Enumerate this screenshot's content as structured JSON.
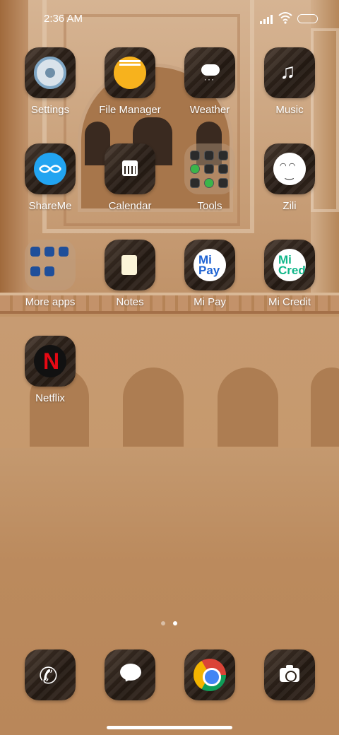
{
  "status_bar": {
    "time": "2:36 AM"
  },
  "apps": [
    {
      "label": "Settings",
      "icon": "settings-icon"
    },
    {
      "label": "File Manager",
      "icon": "file-manager-icon"
    },
    {
      "label": "Weather",
      "icon": "weather-icon"
    },
    {
      "label": "Music",
      "icon": "music-icon"
    },
    {
      "label": "ShareMe",
      "icon": "shareme-icon"
    },
    {
      "label": "Calendar",
      "icon": "calendar-icon"
    },
    {
      "label": "Tools",
      "icon": "tools-folder-icon"
    },
    {
      "label": "Zili",
      "icon": "zili-icon"
    },
    {
      "label": "More apps",
      "icon": "more-apps-folder-icon"
    },
    {
      "label": "Notes",
      "icon": "notes-icon"
    },
    {
      "label": "Mi Pay",
      "icon": "mi-pay-icon",
      "icon_text": "Mi\nPay"
    },
    {
      "label": "Mi Credit",
      "icon": "mi-credit-icon",
      "icon_text": "Mi\nCredit"
    },
    {
      "label": "Netflix",
      "icon": "netflix-icon",
      "icon_text": "N"
    }
  ],
  "page_indicator": {
    "pages": 2,
    "current": 2
  },
  "dock": [
    {
      "icon": "phone-icon"
    },
    {
      "icon": "messages-icon"
    },
    {
      "icon": "chrome-icon"
    },
    {
      "icon": "camera-icon"
    }
  ]
}
